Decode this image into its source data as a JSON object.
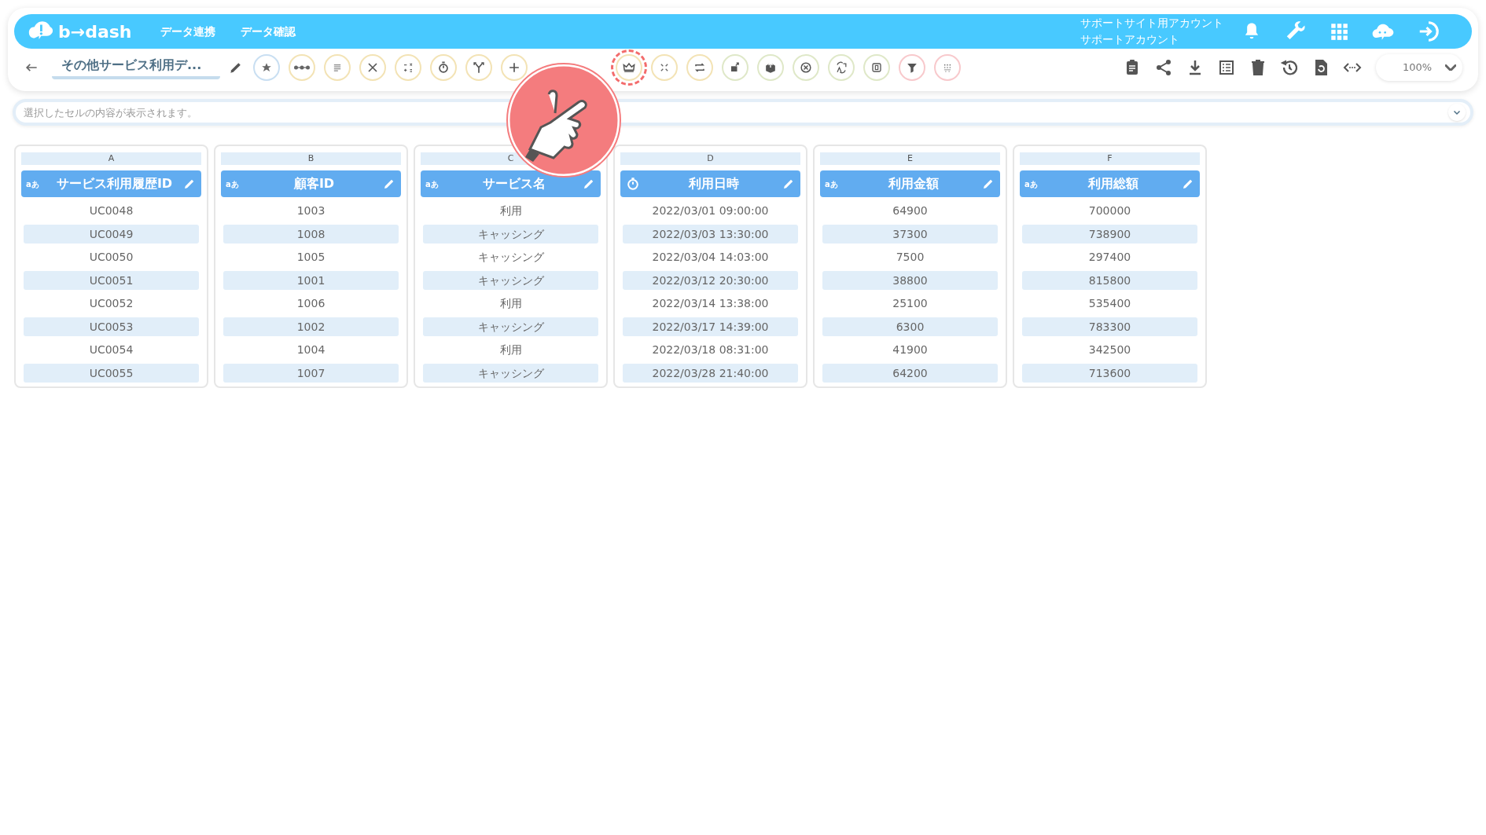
{
  "header": {
    "logo": "b→dash",
    "nav": [
      "データ連携",
      "データ確認"
    ],
    "account": [
      "サポートサイト用アカウント",
      "サポートアカウント"
    ]
  },
  "toolbar": {
    "title": "その他サービス利用デ...",
    "tools": [
      {
        "color": "#c9dff2",
        "highlighted": false
      },
      {
        "color": "#f3e3b5",
        "highlighted": false
      },
      {
        "color": "#f3e3b5",
        "highlighted": false
      },
      {
        "color": "#f3e3b5",
        "highlighted": false
      },
      {
        "color": "#f3e3b5",
        "highlighted": false
      },
      {
        "color": "#f3e3b5",
        "highlighted": false
      },
      {
        "color": "#f3e3b5",
        "highlighted": false
      },
      {
        "color": "#f3e3b5",
        "highlighted": false
      },
      {
        "color": "#f3e3b5",
        "highlighted": true
      },
      {
        "color": "#f3e3b5",
        "highlighted": false
      },
      {
        "color": "#f3e3b5",
        "highlighted": false
      },
      {
        "color": "#dfe8c8",
        "highlighted": false
      },
      {
        "color": "#dfe8c8",
        "highlighted": false
      },
      {
        "color": "#dfe8c8",
        "highlighted": false
      },
      {
        "color": "#dfe8c8",
        "highlighted": false
      },
      {
        "color": "#dfe8c8",
        "highlighted": false
      },
      {
        "color": "#f8c9cc",
        "highlighted": false
      },
      {
        "color": "#f8c9cc",
        "highlighted": false
      }
    ],
    "zoom": "100%"
  },
  "cell_content": {
    "placeholder": "選択したセルの内容が表示されます。"
  },
  "columns": [
    {
      "letter": "A",
      "kind": "text",
      "type_label": "aあ",
      "title": "サービス利用履歴ID",
      "cells": [
        "UC0048",
        "UC0049",
        "UC0050",
        "UC0051",
        "UC0052",
        "UC0053",
        "UC0054",
        "UC0055"
      ]
    },
    {
      "letter": "B",
      "kind": "text",
      "type_label": "aあ",
      "title": "顧客ID",
      "cells": [
        "1003",
        "1008",
        "1005",
        "1001",
        "1006",
        "1002",
        "1004",
        "1007"
      ]
    },
    {
      "letter": "C",
      "kind": "text",
      "type_label": "aあ",
      "title": "サービス名",
      "cells": [
        "利用",
        "キャッシング",
        "キャッシング",
        "キャッシング",
        "利用",
        "キャッシング",
        "利用",
        "キャッシング"
      ]
    },
    {
      "letter": "D",
      "kind": "datetime",
      "title": "利用日時",
      "cells": [
        "2022/03/01 09:00:00",
        "2022/03/03 13:30:00",
        "2022/03/04 14:03:00",
        "2022/03/12 20:30:00",
        "2022/03/14 13:38:00",
        "2022/03/17 14:39:00",
        "2022/03/18 08:31:00",
        "2022/03/28 21:40:00"
      ]
    },
    {
      "letter": "E",
      "kind": "text",
      "type_label": "aあ",
      "title": "利用金額",
      "cells": [
        "64900",
        "37300",
        "7500",
        "38800",
        "25100",
        "6300",
        "41900",
        "64200"
      ]
    },
    {
      "letter": "F",
      "kind": "text",
      "type_label": "aあ",
      "title": "利用総額",
      "cells": [
        "700000",
        "738900",
        "297400",
        "815800",
        "535400",
        "783300",
        "342500",
        "713600"
      ]
    }
  ]
}
